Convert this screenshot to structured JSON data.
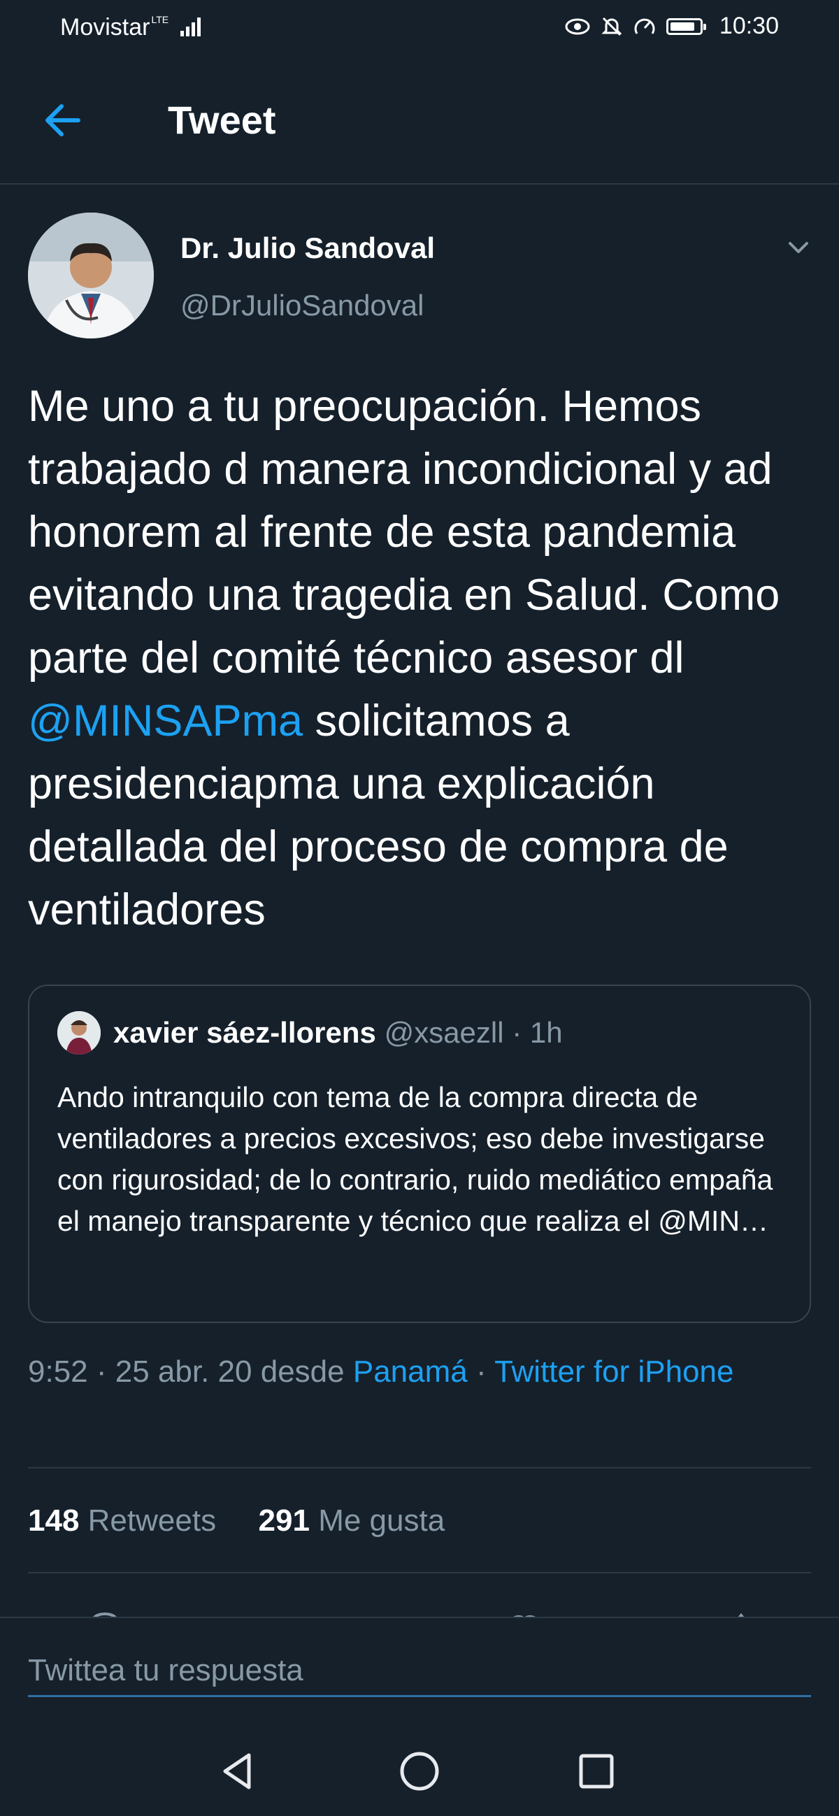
{
  "status_bar": {
    "carrier": "Movistar",
    "network": "LTE",
    "time": "10:30",
    "icons": [
      "eye-comfort-icon",
      "mute-icon",
      "data-saver-icon",
      "battery-icon"
    ]
  },
  "header": {
    "title": "Tweet",
    "back_icon": "back-arrow-icon"
  },
  "tweet": {
    "author_name": "Dr. Julio Sandoval",
    "author_handle": "@DrJulioSandoval",
    "text_before": "Me uno a tu preocupación. Hemos trabajado d manera incondicional y ad honorem al frente de esta pandemia evitando una tragedia en Salud. Como parte del comité técnico asesor dl ",
    "mention": "@MINSAPma",
    "text_after": " solicitamos a presidenciapma una explicación detallada del proceso de compra de ventiladores"
  },
  "quote": {
    "name": "xavier sáez-llorens",
    "handle": "@xsaezll",
    "separator": "·",
    "time": "1h",
    "text": "Ando intranquilo con tema de la compra directa de ventiladores a precios excesivos; eso debe investigarse con rigurosidad; de lo contrario, ruido mediático empaña el manejo transparente y técnico que realiza el @MIN…"
  },
  "meta": {
    "time": "9:52",
    "date": "25 abr. 20",
    "from_label": "desde",
    "location": "Panamá",
    "source": "Twitter for iPhone"
  },
  "stats": {
    "retweets_count": "148",
    "retweets_label": "Retweets",
    "likes_count": "291",
    "likes_label": "Me gusta"
  },
  "reply": {
    "placeholder": "Twittea tu respuesta"
  },
  "colors": {
    "background": "#15202b",
    "accent": "#1da1f2",
    "secondary_text": "#8899a6",
    "divider": "#2b3946"
  }
}
